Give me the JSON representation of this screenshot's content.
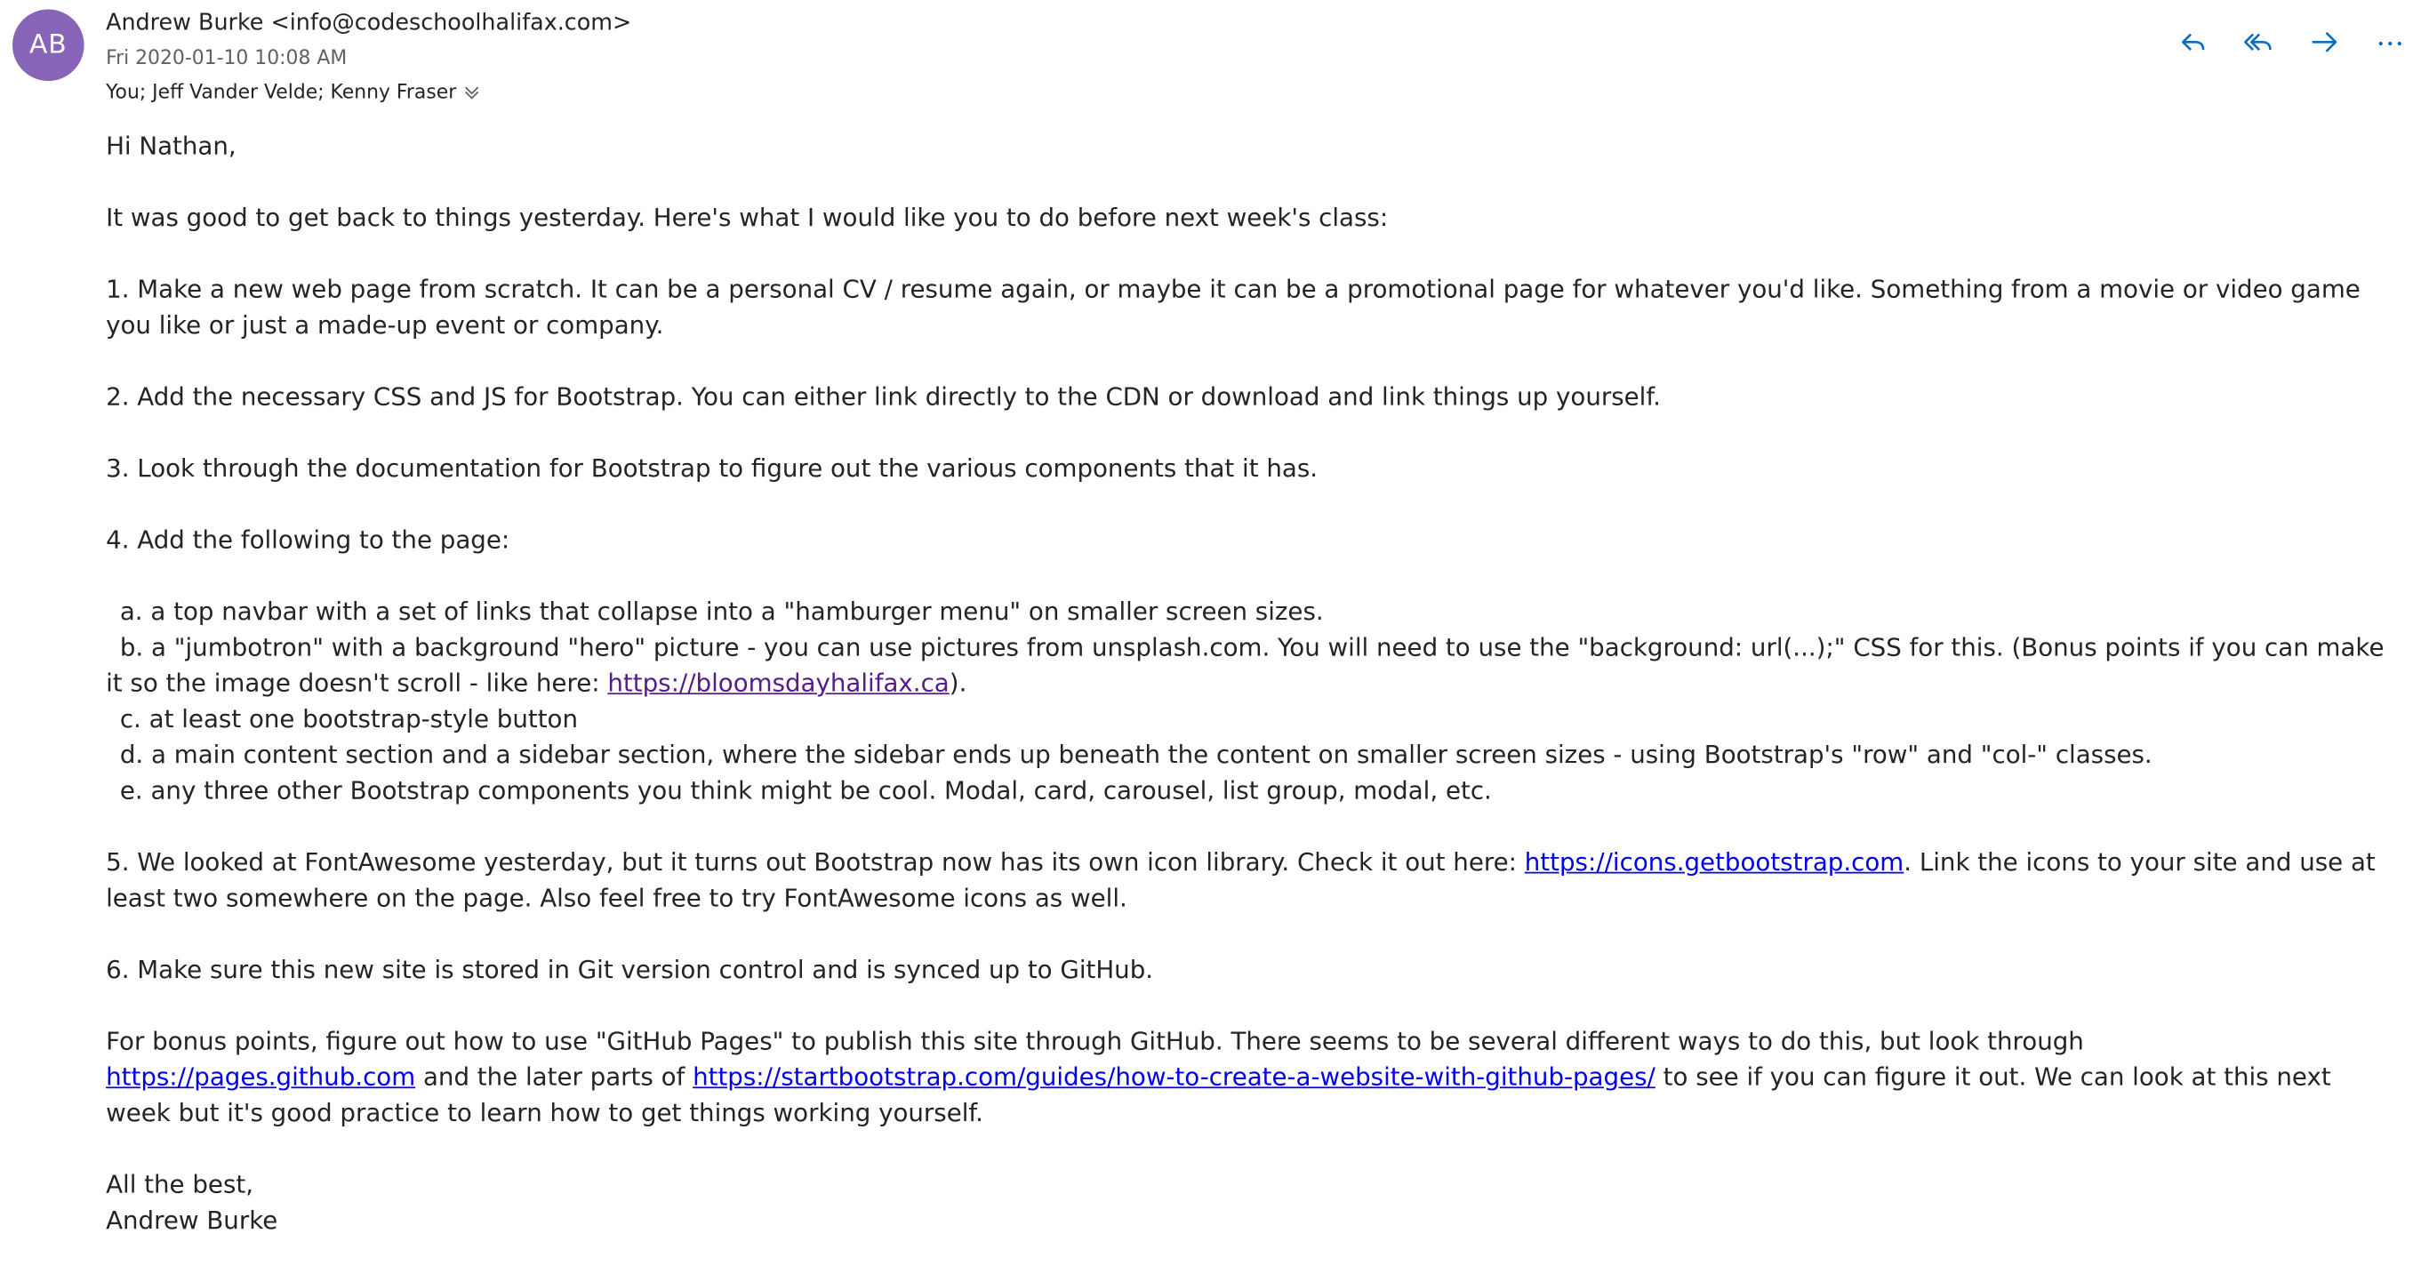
{
  "header": {
    "avatar_initials": "AB",
    "avatar_color": "#8764b8",
    "sender": "Andrew Burke <info@codeschoolhalifax.com>",
    "date": "Fri 2020-01-10 10:08 AM",
    "recipients": "You; Jeff Vander Velde; Kenny Fraser"
  },
  "actions": {
    "reply_icon": "reply-icon",
    "reply_all_icon": "reply-all-icon",
    "forward_icon": "forward-icon",
    "more_icon": "more-icon",
    "accent_color": "#0f6cbd"
  },
  "body": {
    "greeting": "Hi Nathan,",
    "intro": "It was good to get back to things yesterday. Here's what I would like you to do before next week's class:",
    "item1": "1. Make a new web page from scratch. It can be a personal CV / resume again, or maybe it can be a promotional page for whatever you'd like. Something from a movie or video game you like or just a made-up event or company.",
    "item2": "2. Add the necessary CSS and JS for Bootstrap. You can either link directly to the CDN or download and link things up yourself.",
    "item3": "3. Look through the documentation for Bootstrap to figure out the various components that it has.",
    "item4": "4. Add the following to the page:",
    "item4a": "a. a top navbar with a set of links that collapse into a \"hamburger menu\" on smaller screen sizes.",
    "item4b_pre": "b. a \"jumbotron\" with a background \"hero\" picture - you can use pictures from unsplash.com. You will need to use the \"background: url(...);\" CSS for this. (Bonus points if you can make it so the image doesn't scroll - like here: ",
    "item4b_link": "https://bloomsdayhalifax.ca",
    "item4b_post": ").",
    "item4c": "c. at least one bootstrap-style button",
    "item4d": "d. a main content section and a sidebar section, where the sidebar ends up beneath the content on smaller screen sizes - using Bootstrap's \"row\" and \"col-\" classes.",
    "item4e": "e. any three other Bootstrap components you think might be cool. Modal, card, carousel, list group, modal, etc.",
    "item5_pre": "5. We looked at FontAwesome yesterday, but it turns out Bootstrap now has its own icon library. Check it out here: ",
    "item5_link": "https://icons.getbootstrap.com",
    "item5_post": ". Link the icons to your site and use at least two somewhere on the page. Also feel free to try FontAwesome icons as well.",
    "item6": "6. Make sure this new site is stored in Git version control and is synced up to GitHub.",
    "bonus_pre": "For bonus points, figure out how to use \"GitHub Pages\" to publish this site through GitHub. There seems to be several different ways to do this, but look through ",
    "bonus_link1": "https://pages.github.com",
    "bonus_mid": " and the later parts of ",
    "bonus_link2": "https://startbootstrap.com/guides/how-to-create-a-website-with-github-pages/",
    "bonus_post": " to see if you can figure it out. We can look at this next week but it's good practice to learn how to get things working yourself.",
    "signoff": "All the best,",
    "signature": "Andrew Burke"
  }
}
